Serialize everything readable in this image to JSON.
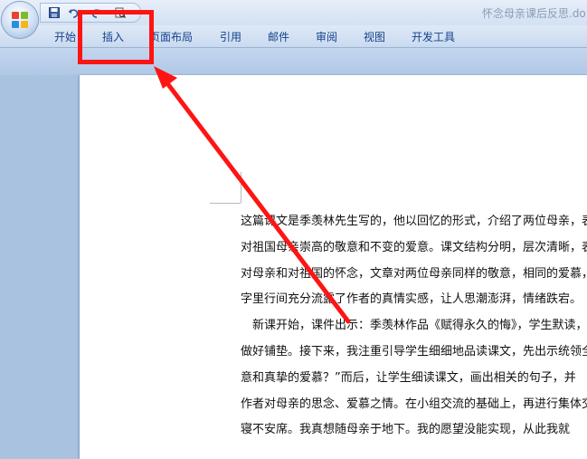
{
  "window": {
    "title": "怀念母亲课后反思.do"
  },
  "ribbon": {
    "tabs": [
      {
        "label": "开始"
      },
      {
        "label": "插入"
      },
      {
        "label": "页面布局"
      },
      {
        "label": "引用"
      },
      {
        "label": "邮件"
      },
      {
        "label": "审阅"
      },
      {
        "label": "视图"
      },
      {
        "label": "开发工具"
      }
    ]
  },
  "document": {
    "lines": [
      "这篇课文是季羡林先生写的，他以回忆的形式，介绍了两位母亲，表",
      "对祖国母亲崇高的敬意和不变的爱意。课文结构分明，层次清晰，表",
      "对母亲和对祖国的怀念，文章对两位母亲同样的敬意，相同的爱慕，",
      "字里行间充分流露了作者的真情实感，让人思潮澎湃，情绪跌宕。",
      "　新课开始，课件出示：季羡林作品《赋得永久的悔》，学生默读，",
      "做好铺垫。接下来，我注重引导学生细细地品读课文，先出示统领全",
      "意和真挚的爱慕？”而后，让学生细读课文，画出相关的句子，并",
      "作者对母亲的思念、爱慕之情。在小组交流的基础上，再进行集体交",
      "寝不安席。我真想随母亲于地下。我的愿望没能实现，从此我就"
    ]
  },
  "colors": {
    "annotation": "#ff1414",
    "tab_text": "#15428b"
  },
  "icons": {
    "office_button": "office-logo-icon",
    "save": "save-icon",
    "undo": "undo-icon",
    "redo": "redo-icon",
    "print_preview": "print-preview-icon"
  }
}
